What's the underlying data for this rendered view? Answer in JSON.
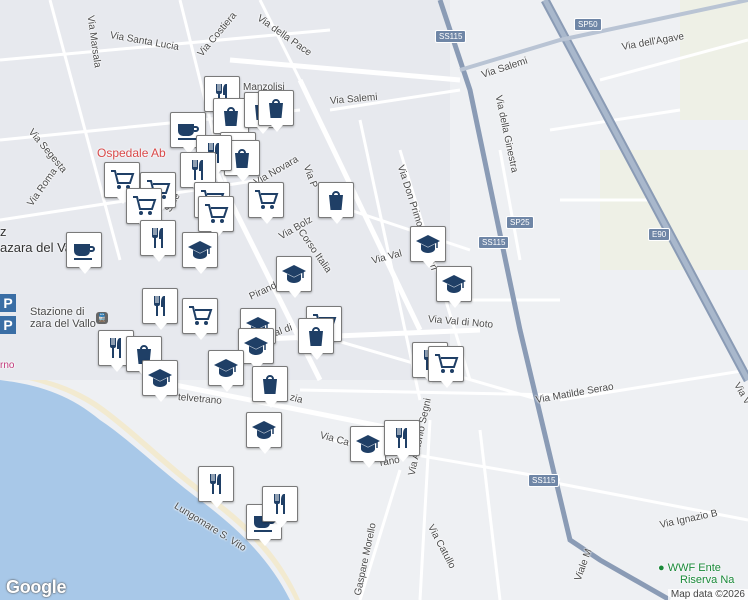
{
  "map": {
    "streets": [
      "Via Marsala",
      "Via Santa Lucia",
      "Via Costiera",
      "Via della Pace",
      "Via Salemi",
      "Via Salemi",
      "Via dell'Agave",
      "Via della Ginestra",
      "Via Segesta",
      "Via Roma",
      "Via Novara",
      "Via Don Primo Mazzolari",
      "Via Bolz",
      "Corso Italia",
      "Via Val",
      "Via Val di Noto",
      "Via Matilde Serao",
      "Via Antonio Segni",
      "Via Ca",
      "rano",
      "Via Catullo",
      "Gaspare Morello",
      "Lungomare S. Vito",
      "Via Ignazio B",
      "Viale M",
      "Via P",
      "Sale",
      "Pirand",
      "val di",
      "telvetrano",
      "zia",
      "Manzolisi",
      "Via V"
    ],
    "road_shields": [
      "SS115",
      "SP50",
      "SP25",
      "SS115",
      "SS115",
      "E90"
    ],
    "city_label": "azara del Vallo",
    "city_label_prefix": "z",
    "station_label": [
      "Stazione di",
      "zara del Vallo"
    ],
    "hospital_label": "Ospedale Ab",
    "museum_label": "rno",
    "poi_label": [
      "WWF Ente",
      "Riserva Na"
    ],
    "google_logo": "Google",
    "attribution": "Map data ©2026",
    "markers": [
      {
        "icon": "restaurant"
      },
      {
        "icon": "shopping-bag"
      },
      {
        "icon": "shopping-bag"
      },
      {
        "icon": "shopping-bag"
      },
      {
        "icon": "cafe"
      },
      {
        "icon": "shopping-bag"
      },
      {
        "icon": "shopping-bag"
      },
      {
        "icon": "restaurant"
      },
      {
        "icon": "cart"
      },
      {
        "icon": "restaurant"
      },
      {
        "icon": "cart"
      },
      {
        "icon": "cart"
      },
      {
        "icon": "cart"
      },
      {
        "icon": "shopping-bag"
      },
      {
        "icon": "cart"
      },
      {
        "icon": "cart"
      },
      {
        "icon": "cafe"
      },
      {
        "icon": "restaurant"
      },
      {
        "icon": "school"
      },
      {
        "icon": "school"
      },
      {
        "icon": "school"
      },
      {
        "icon": "school"
      },
      {
        "icon": "restaurant"
      },
      {
        "icon": "cart"
      },
      {
        "icon": "school"
      },
      {
        "icon": "cart"
      },
      {
        "icon": "school"
      },
      {
        "icon": "shopping-bag"
      },
      {
        "icon": "restaurant"
      },
      {
        "icon": "shopping-bag"
      },
      {
        "icon": "school"
      },
      {
        "icon": "school"
      },
      {
        "icon": "shopping-bag"
      },
      {
        "icon": "school"
      },
      {
        "icon": "school"
      },
      {
        "icon": "restaurant"
      },
      {
        "icon": "restaurant"
      },
      {
        "icon": "cart"
      },
      {
        "icon": "restaurant"
      },
      {
        "icon": "cafe"
      },
      {
        "icon": "restaurant"
      }
    ],
    "colors": {
      "sea": "#a8c8e8",
      "marker_icon": "#1f3f66",
      "highway": "#8a9bb5",
      "poi_green": "#1b8a3a"
    }
  }
}
